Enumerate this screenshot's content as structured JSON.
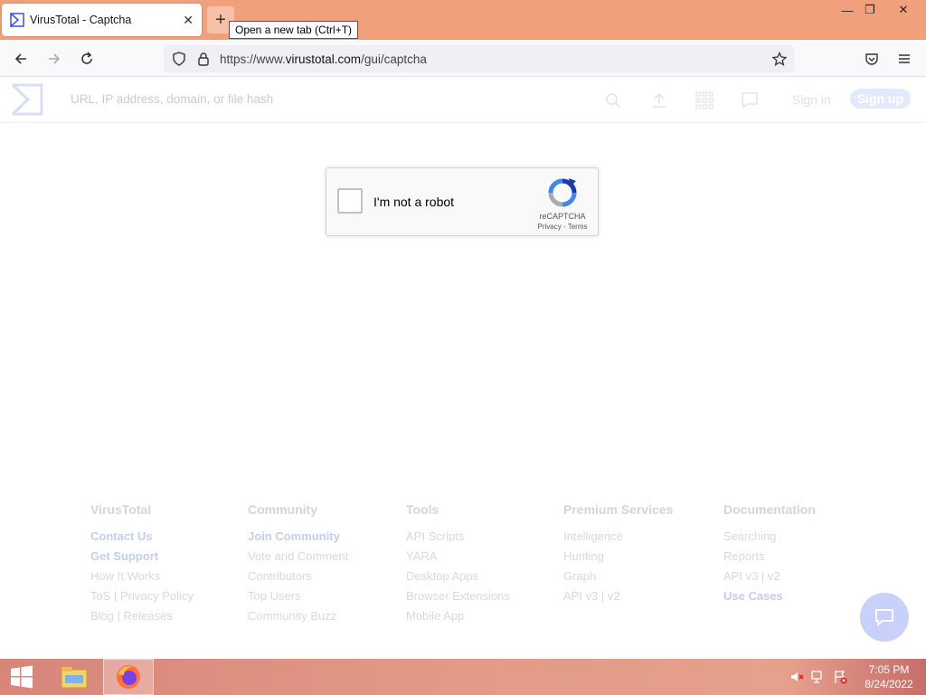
{
  "browser": {
    "tab_title": "VirusTotal - Captcha",
    "tooltip": "Open a new tab (Ctrl+T)",
    "url_prefix": "https://www.",
    "url_domain": "virustotal.com",
    "url_path": "/gui/captcha"
  },
  "vt_header": {
    "search_placeholder": "URL, IP address, domain, or file hash",
    "sign_in": "Sign in",
    "sign_up": "Sign up"
  },
  "captcha": {
    "label": "I'm not a robot",
    "brand": "reCAPTCHA",
    "links": "Privacy - Terms"
  },
  "footer": {
    "columns": [
      {
        "title": "VirusTotal",
        "items": [
          {
            "label": "Contact Us",
            "bold": true
          },
          {
            "label": "Get Support",
            "bold": true
          },
          {
            "label": "How It Works"
          },
          {
            "label": "ToS | Privacy Policy"
          },
          {
            "label": "Blog | Releases"
          }
        ]
      },
      {
        "title": "Community",
        "items": [
          {
            "label": "Join Community",
            "bold": true
          },
          {
            "label": "Vote and Comment"
          },
          {
            "label": "Contributors"
          },
          {
            "label": "Top Users"
          },
          {
            "label": "Community Buzz"
          }
        ]
      },
      {
        "title": "Tools",
        "items": [
          {
            "label": "API Scripts"
          },
          {
            "label": "YARA"
          },
          {
            "label": "Desktop Apps"
          },
          {
            "label": "Browser Extensions"
          },
          {
            "label": "Mobile App"
          }
        ]
      },
      {
        "title": "Premium Services",
        "items": [
          {
            "label": "Intelligence"
          },
          {
            "label": "Hunting"
          },
          {
            "label": "Graph"
          },
          {
            "label": "API v3 | v2"
          }
        ]
      },
      {
        "title": "Documentation",
        "items": [
          {
            "label": "Searching"
          },
          {
            "label": "Reports"
          },
          {
            "label": "API v3 | v2"
          },
          {
            "label": "Use Cases",
            "bold": true
          }
        ]
      }
    ]
  },
  "taskbar": {
    "time": "7:05 PM",
    "date": "8/24/2022"
  },
  "colors": {
    "titlebar": "#f0a07a",
    "vt_accent": "#394eff",
    "taskbar": "#e39a88"
  }
}
